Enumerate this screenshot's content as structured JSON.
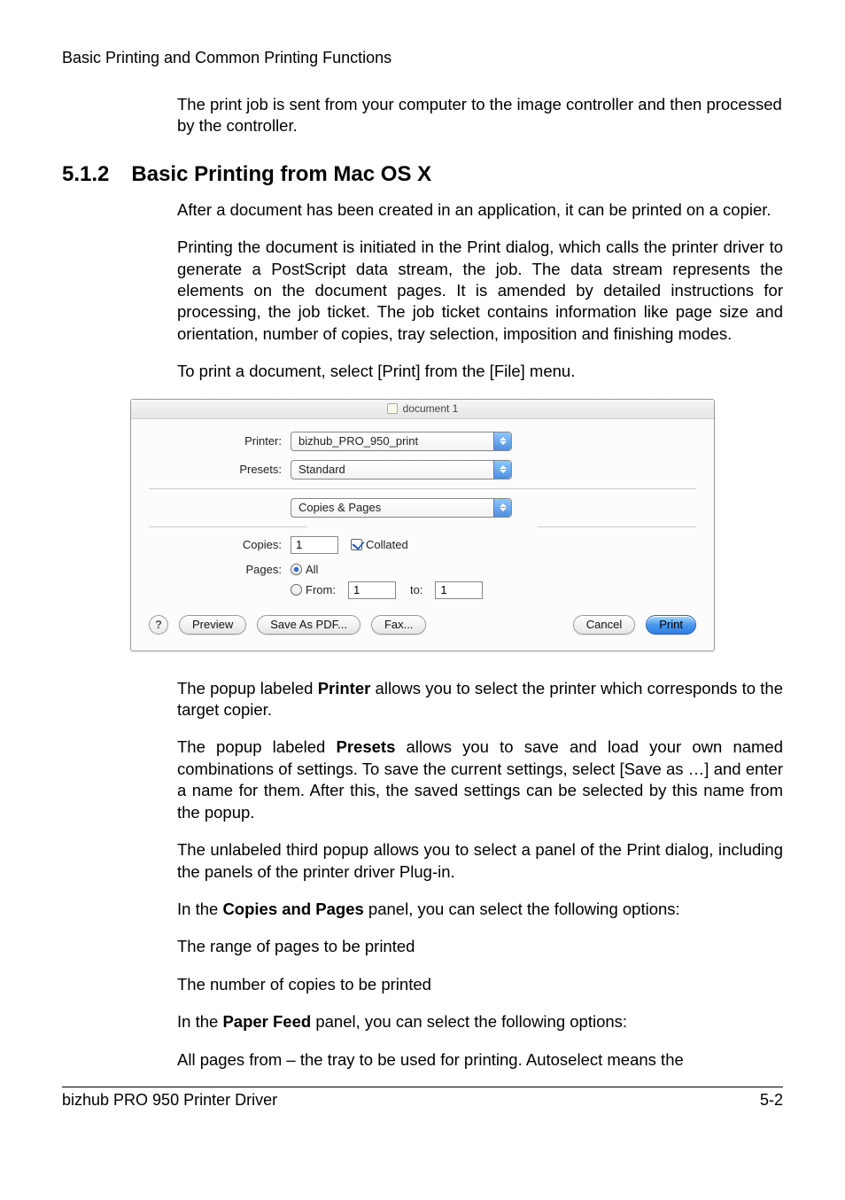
{
  "header": {
    "running": "Basic Printing and Common Printing Functions"
  },
  "intro_para": "The print job is sent from your computer to the image controller and then processed by the controller.",
  "h2": {
    "num": "5.1.2",
    "title": "Basic Printing from Mac OS X"
  },
  "p1": "After a document has been created in an application, it can be printed on a copier.",
  "p2": "Printing the document is initiated in the Print dialog, which calls the printer driver to generate a PostScript data stream, the job. The data stream represents the elements on the document pages. It is amended by detailed instructions for processing, the job ticket. The job ticket contains information like page size and orientation, number of copies, tray selection, imposition and finishing modes.",
  "p3": "To print a document, select [Print] from the [File] menu.",
  "dialog": {
    "title": "document 1",
    "printer_label": "Printer:",
    "printer_value": "bizhub_PRO_950_print",
    "presets_label": "Presets:",
    "presets_value": "Standard",
    "panel_value": "Copies & Pages",
    "copies_label": "Copies:",
    "copies_value": "1",
    "collated_label": "Collated",
    "pages_label": "Pages:",
    "all_label": "All",
    "from_label": "From:",
    "from_value": "1",
    "to_label": "to:",
    "to_value": "1",
    "help": "?",
    "buttons": {
      "preview": "Preview",
      "saveaspdf": "Save As PDF...",
      "fax": "Fax...",
      "cancel": "Cancel",
      "print": "Print"
    }
  },
  "after_1a": "The popup labeled ",
  "after_1b": "Printer",
  "after_1c": " allows you to select the printer which corresponds to the target copier.",
  "after_2a": "The popup labeled ",
  "after_2b": "Presets",
  "after_2c": " allows you to save and load your own named combinations of settings. To save the current settings, select [Save as …] and enter a name for them. After this, the saved settings can be selected by this name from the popup.",
  "after_3": "The unlabeled third popup allows you to select a panel of the Print dialog, including the panels of the printer driver Plug-in.",
  "after_4a": "In the ",
  "after_4b": "Copies and Pages",
  "after_4c": " panel, you can select the following options:",
  "after_5": "The range of pages to be printed",
  "after_6": "The number of copies to be printed",
  "after_7a": "In the ",
  "after_7b": "Paper Feed",
  "after_7c": " panel, you can select the following options:",
  "after_8": "All pages from – the tray to be used for printing. Autoselect means the",
  "footer": {
    "left": "bizhub PRO 950 Printer Driver",
    "right": "5-2"
  }
}
